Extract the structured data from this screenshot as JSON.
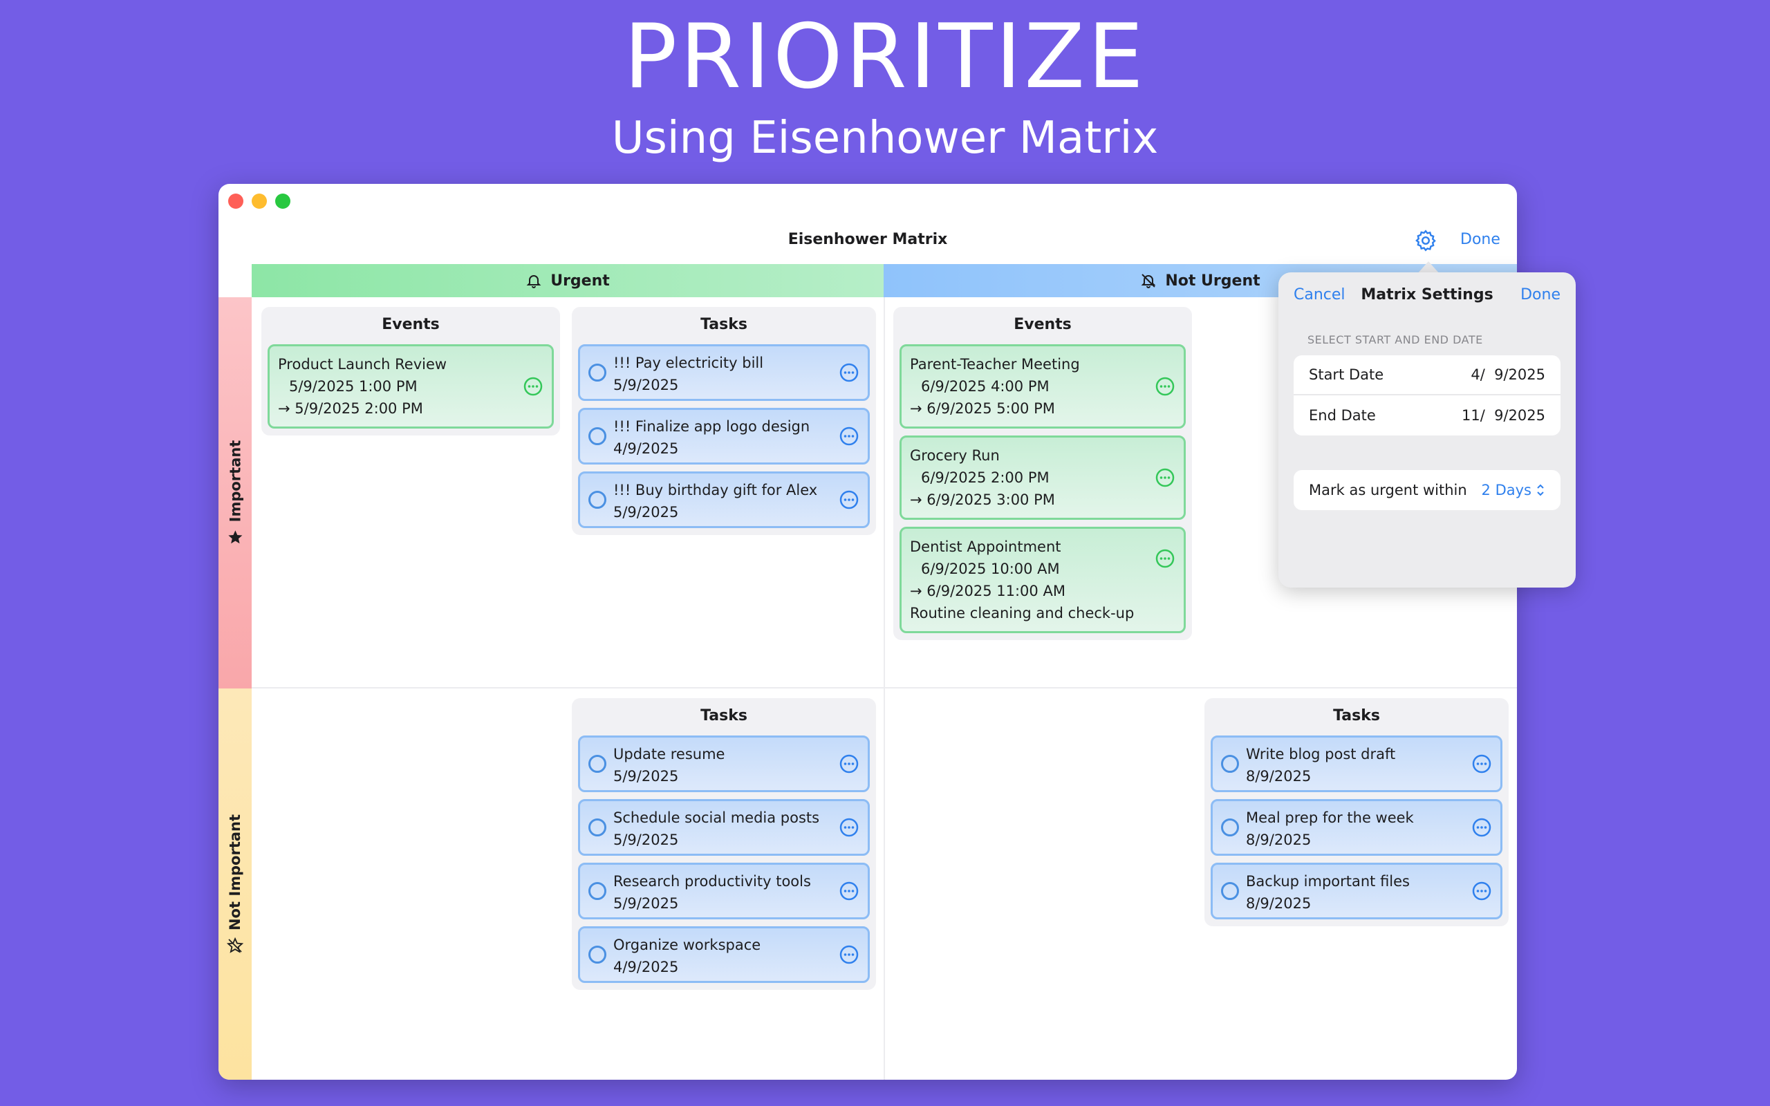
{
  "hero": {
    "title": "PRIORITIZE",
    "subtitle": "Using Eisenhower Matrix"
  },
  "window": {
    "title": "Eisenhower Matrix",
    "done_label": "Done",
    "settings_icon": "gear-icon"
  },
  "columns": {
    "urgent": "Urgent",
    "not_urgent": "Not Urgent"
  },
  "rows": {
    "important": "Important",
    "not_important": "Not Important"
  },
  "quadrants": {
    "important_urgent": {
      "events_title": "Events",
      "events": [
        {
          "title": "Product Launch Review",
          "start": "5/9/2025 1:00 PM",
          "end": "→ 5/9/2025 2:00 PM",
          "note": ""
        }
      ],
      "tasks_title": "Tasks",
      "tasks": [
        {
          "title": "!!! Pay electricity bill",
          "date": "5/9/2025"
        },
        {
          "title": "!!! Finalize app logo design",
          "date": "4/9/2025"
        },
        {
          "title": "!!! Buy birthday gift for Alex",
          "date": "5/9/2025"
        }
      ]
    },
    "important_not_urgent": {
      "events_title": "Events",
      "events": [
        {
          "title": "Parent-Teacher Meeting",
          "start": "6/9/2025 4:00 PM",
          "end": "→ 6/9/2025 5:00 PM",
          "note": ""
        },
        {
          "title": "Grocery Run",
          "start": "6/9/2025 2:00 PM",
          "end": "→ 6/9/2025 3:00 PM",
          "note": ""
        },
        {
          "title": "Dentist Appointment",
          "start": "6/9/2025 10:00 AM",
          "end": "→ 6/9/2025 11:00 AM",
          "note": "Routine cleaning and check-up"
        }
      ]
    },
    "not_important_urgent": {
      "tasks_title": "Tasks",
      "tasks": [
        {
          "title": "Update resume",
          "date": "5/9/2025"
        },
        {
          "title": "Schedule social media posts",
          "date": "5/9/2025"
        },
        {
          "title": "Research productivity tools",
          "date": "5/9/2025"
        },
        {
          "title": "Organize workspace",
          "date": "4/9/2025"
        }
      ]
    },
    "not_important_not_urgent": {
      "tasks_title": "Tasks",
      "tasks": [
        {
          "title": "Write blog post draft",
          "date": "8/9/2025"
        },
        {
          "title": "Meal prep for the week",
          "date": "8/9/2025"
        },
        {
          "title": "Backup important files",
          "date": "8/9/2025"
        }
      ]
    }
  },
  "settings": {
    "cancel_label": "Cancel",
    "title": "Matrix Settings",
    "done_label": "Done",
    "section_header": "SELECT START AND END DATE",
    "start_date_label": "Start Date",
    "start_date_value": "4/  9/2025",
    "end_date_label": "End Date",
    "end_date_value": "11/  9/2025",
    "urgent_label": "Mark as urgent within",
    "urgent_value": "2 Days"
  },
  "colors": {
    "background": "#735de6",
    "accent": "#2f80ed",
    "event_border": "#7fd99a",
    "task_border": "#8cbcf5"
  }
}
